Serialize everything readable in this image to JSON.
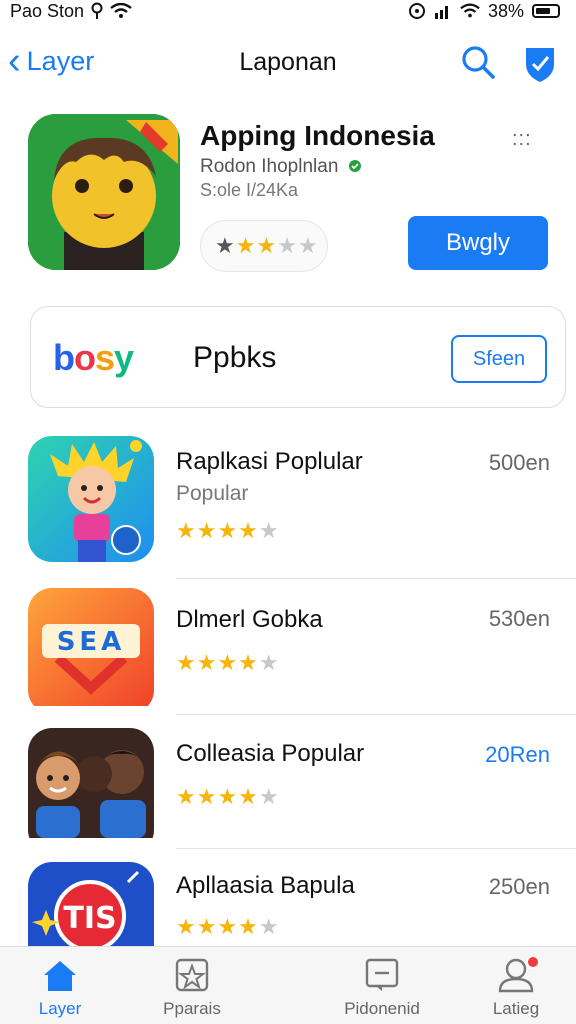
{
  "status_bar": {
    "carrier": "Pao Ston",
    "battery": "38%"
  },
  "nav": {
    "back_label": "Layer",
    "title": "Laponan"
  },
  "featured": {
    "title": "Apping Indonesia",
    "subtitle": "Rodon Ihoplnlan",
    "meta": "S:ole I/24Ka",
    "more": ":::",
    "rating_stars": 2.5,
    "button_label": "Bwgly"
  },
  "banner": {
    "logo": {
      "b": "b",
      "o": "o",
      "s": "s",
      "y": "y"
    },
    "title": "Ppbks",
    "button_label": "Sfeen"
  },
  "apps": [
    {
      "name": "Raplkasi Poplular",
      "category": "Popular",
      "rating": 4,
      "price": "500en",
      "price_color": "gray"
    },
    {
      "name": "Dlmerl Gobka",
      "category": "",
      "rating": 4,
      "price": "530en",
      "price_color": "gray"
    },
    {
      "name": "Colleasia Popular",
      "category": "",
      "rating": 4,
      "price": "20Ren",
      "price_color": "blue"
    },
    {
      "name": "Apllaasia Bapula",
      "category": "",
      "rating": 4,
      "price": "250en",
      "price_color": "gray"
    }
  ],
  "icon_texts": {
    "app2": "SEA",
    "app4": "TIS"
  },
  "tabs": [
    {
      "label": "Layer",
      "icon": "home-icon",
      "active": true
    },
    {
      "label": "Pparais",
      "icon": "star-box-icon",
      "active": false
    },
    {
      "label": "Pidonenid",
      "icon": "message-icon",
      "active": false
    },
    {
      "label": "Latieg",
      "icon": "person-icon",
      "active": false
    }
  ],
  "colors": {
    "accent": "#1a7cf5",
    "star": "#f5b50a",
    "badge": "#ef3b3b"
  }
}
